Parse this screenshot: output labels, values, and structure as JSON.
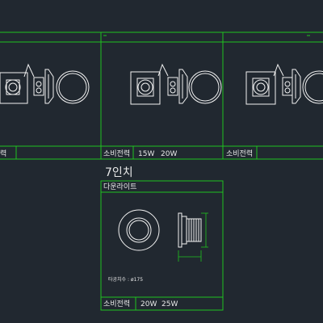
{
  "colors": {
    "background": "#212830",
    "frame": "#1fc21f",
    "drawing": "#f2f2f2",
    "text": "#e8e8e8"
  },
  "top_row": {
    "power_label": "소비전력",
    "power_label_cut": "력",
    "cell2_watts": [
      "15W",
      "20W"
    ]
  },
  "seven_inch": {
    "title": "7인치",
    "product_name": "다운라이트",
    "cut_size": "타공치수 : ø175",
    "power_label": "소비전력",
    "watts": [
      "20W",
      "25W"
    ]
  }
}
